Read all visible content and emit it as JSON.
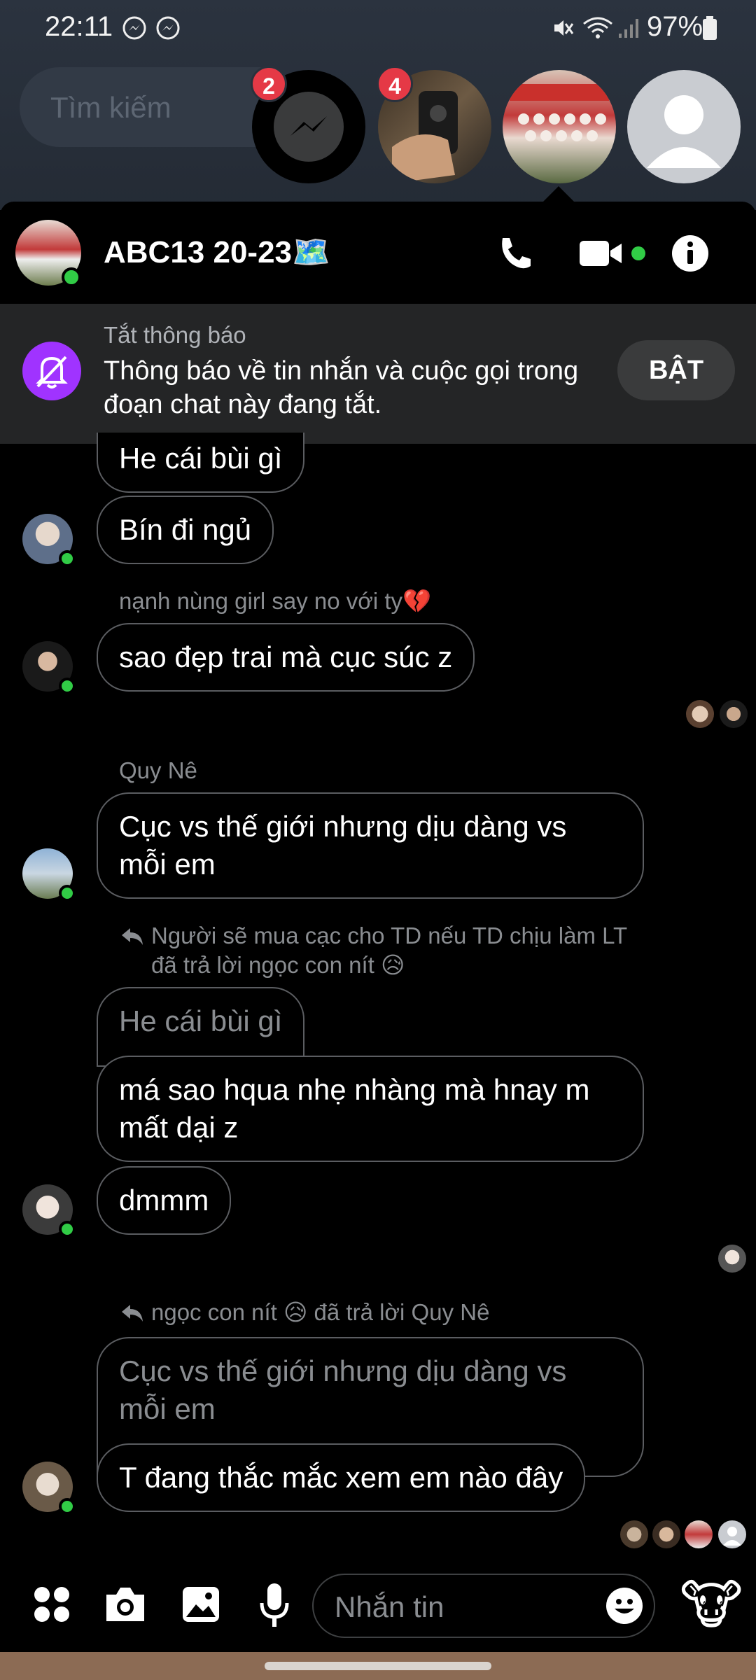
{
  "status_bar": {
    "time": "22:11",
    "battery": "97%"
  },
  "search": {
    "placeholder": "Tìm kiếm"
  },
  "chat_heads": [
    {
      "name": "messenger",
      "badge": "2"
    },
    {
      "name": "hand-photo",
      "badge": "4"
    },
    {
      "name": "group-photo",
      "badge": ""
    },
    {
      "name": "default-avatar",
      "badge": ""
    }
  ],
  "chat": {
    "title": "ABC13 20-23🗺️"
  },
  "mute_banner": {
    "title": "Tắt thông báo",
    "description": "Thông báo về tin nhắn và cuộc gọi trong đoạn chat này đang tắt.",
    "button_label": "BẬT"
  },
  "messages": [
    {
      "type": "bubble",
      "text": "He cái bùi gì"
    },
    {
      "type": "bubble",
      "text": "Bín đi ngủ"
    },
    {
      "type": "sender",
      "text": "nạnh nùng girl say no với ty💔"
    },
    {
      "type": "bubble",
      "text": "sao đẹp trai mà cục súc z"
    },
    {
      "type": "sender",
      "text": "Quy Nê"
    },
    {
      "type": "bubble",
      "text": "Cục vs thế giới nhưng dịu dàng vs mỗi em"
    },
    {
      "type": "reply",
      "text": "Người sẽ mua cạc cho TD nếu TD chịu làm LT đã trả lời ngọc con nít 😥"
    },
    {
      "type": "quote",
      "text": "He cái bùi gì"
    },
    {
      "type": "bubble",
      "text": "má sao hqua nhẹ nhàng mà hnay m mất dại z"
    },
    {
      "type": "bubble",
      "text": "dmmm"
    },
    {
      "type": "reply",
      "text": "ngọc con nít 😥 đã trả lời Quy Nê"
    },
    {
      "type": "quote",
      "text": "Cục vs thế giới nhưng dịu dàng vs mỗi em"
    },
    {
      "type": "bubble",
      "text": "T đang thắc mắc xem em nào đây"
    }
  ],
  "composer": {
    "placeholder": "Nhắn tin",
    "reaction_emoji": "🐮"
  },
  "colors": {
    "online": "#31cc46",
    "badge": "#e53946",
    "mute_icon": "#a033ff"
  }
}
